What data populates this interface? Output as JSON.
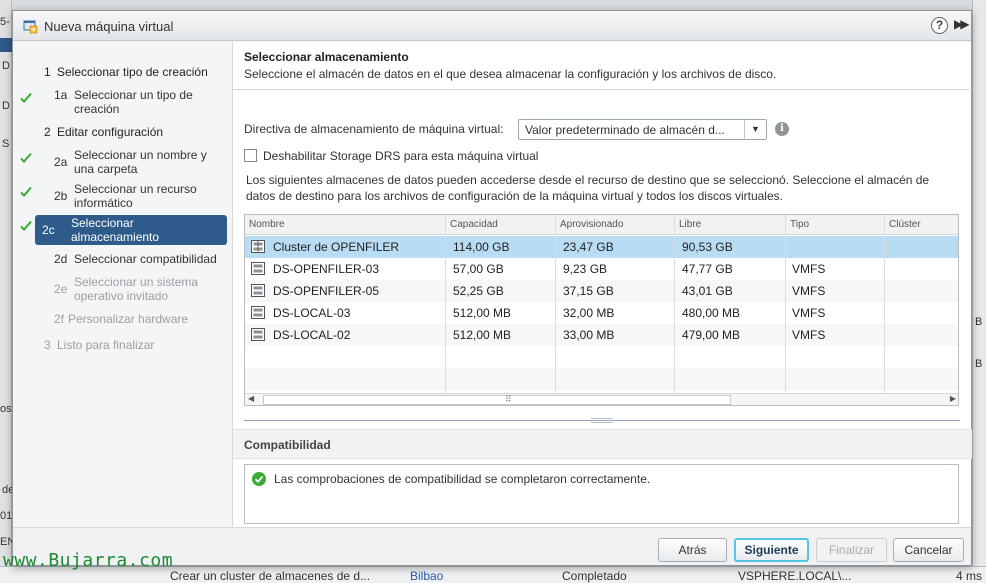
{
  "dialog": {
    "title": "Nueva máquina virtual"
  },
  "nav": {
    "steps": [
      {
        "num": "1",
        "label": "Seleccionar tipo de creación"
      },
      {
        "num": "1a",
        "label": "Seleccionar un tipo de creación"
      },
      {
        "num": "2",
        "label": "Editar configuración"
      },
      {
        "num": "2a",
        "label": "Seleccionar un nombre y una carpeta"
      },
      {
        "num": "2b",
        "label": "Seleccionar un recurso informático"
      },
      {
        "num": "2c",
        "label": "Seleccionar almacenamiento"
      },
      {
        "num": "2d",
        "label": "Seleccionar compatibilidad"
      },
      {
        "num": "2e",
        "label": "Seleccionar un sistema operativo invitado"
      },
      {
        "num": "2f",
        "label": "Personalizar hardware"
      },
      {
        "num": "3",
        "label": "Listo para finalizar"
      }
    ]
  },
  "main": {
    "title": "Seleccionar almacenamiento",
    "subtitle": "Seleccione el almacén de datos en el que desea almacenar la configuración y los archivos de disco.",
    "policy_label": "Directiva de almacenamiento de máquina virtual:",
    "policy_value": "Valor predeterminado de almacén d...",
    "sdrs_label": "Deshabilitar Storage DRS para esta máquina virtual",
    "description": "Los siguientes almacenes de datos pueden accederse desde el recurso de destino que se seleccionó. Seleccione el almacén de datos de destino para los archivos de configuración de la máquina virtual y todos los discos virtuales.",
    "columns": [
      "Nombre",
      "Capacidad",
      "Aprovisionado",
      "Libre",
      "Tipo",
      "Clúster"
    ],
    "rows": [
      {
        "name": "Cluster de OPENFILER",
        "capacity": "114,00 GB",
        "provisioned": "23,47 GB",
        "free": "90,53 GB",
        "type": "",
        "cluster": ""
      },
      {
        "name": "DS-OPENFILER-03",
        "capacity": "57,00 GB",
        "provisioned": "9,23 GB",
        "free": "47,77 GB",
        "type": "VMFS",
        "cluster": ""
      },
      {
        "name": "DS-OPENFILER-05",
        "capacity": "52,25 GB",
        "provisioned": "37,15 GB",
        "free": "43,01 GB",
        "type": "VMFS",
        "cluster": ""
      },
      {
        "name": "DS-LOCAL-03",
        "capacity": "512,00 MB",
        "provisioned": "32,00 MB",
        "free": "480,00 MB",
        "type": "VMFS",
        "cluster": ""
      },
      {
        "name": "DS-LOCAL-02",
        "capacity": "512,00 MB",
        "provisioned": "33,00 MB",
        "free": "479,00 MB",
        "type": "VMFS",
        "cluster": ""
      }
    ],
    "compat_title": "Compatibilidad",
    "compat_message": "Las comprobaciones de compatibilidad se completaron correctamente."
  },
  "footer": {
    "back": "Atrás",
    "next": "Siguiente",
    "finish": "Finalizar",
    "cancel": "Cancelar"
  },
  "background": {
    "task_name": "Crear un cluster de almacenes de d...",
    "task_target": "Bilbao",
    "task_status": "Completado",
    "task_initiator": "VSPHERE.LOCAL\\...",
    "task_time": "4 ms",
    "left_fragments": [
      "5-",
      "D",
      "D",
      "S",
      "os",
      "de",
      "01",
      "EN",
      "N"
    ],
    "right_fragments": [
      "B",
      "B"
    ]
  },
  "watermark": "www.Bujarra.com",
  "colors": {
    "accent": "#2e5b8a",
    "selection": "#b9dcf5",
    "check_green": "#3aaa35",
    "primary_border": "#57c4e5"
  }
}
